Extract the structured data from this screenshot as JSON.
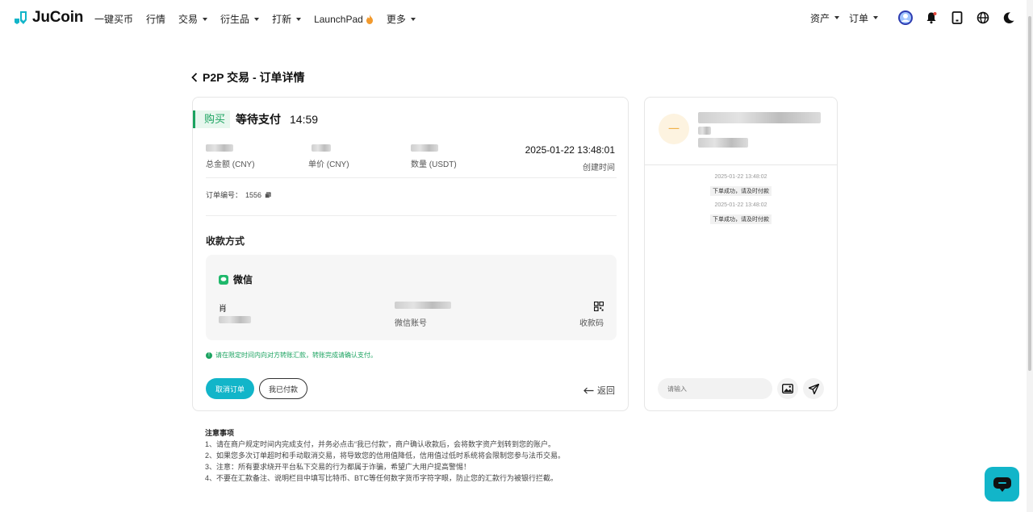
{
  "nav": {
    "brand": "JuCoin",
    "items": [
      {
        "label": "一键买币",
        "dropdown": false
      },
      {
        "label": "行情",
        "dropdown": false
      },
      {
        "label": "交易",
        "dropdown": true
      },
      {
        "label": "衍生品",
        "dropdown": true
      },
      {
        "label": "打新",
        "dropdown": true
      },
      {
        "label": "LaunchPad",
        "dropdown": false
      },
      {
        "label": "更多",
        "dropdown": true
      }
    ],
    "right_items": [
      {
        "label": "资产"
      },
      {
        "label": "订单"
      }
    ],
    "icons": [
      "avatar-icon",
      "bell-icon",
      "download-icon",
      "globe-icon",
      "moon-icon"
    ]
  },
  "page": {
    "title": "P2P 交易 - 订单详情"
  },
  "order": {
    "side": "购买",
    "status": "等待支付",
    "countdown": "14:59",
    "total_label": "总金额 (CNY)",
    "price_label": "单价 (CNY)",
    "qty_label": "数量 (USDT)",
    "created_time": "2025-01-22 13:48:01",
    "created_label": "创建时间",
    "order_no_label": "订单编号：",
    "order_no": "1556"
  },
  "payment": {
    "section_title": "收款方式",
    "method": "微信",
    "name_initial": "肖",
    "account_label": "微信账号",
    "qr_label": "收款码",
    "notice": "请在限定时间内向对方转账汇款，转账完成请确认支付。"
  },
  "actions": {
    "cancel": "取消订单",
    "paid": "我已付款",
    "back": "返回"
  },
  "chat": {
    "avatar_letter": "一",
    "messages": [
      {
        "time": "2025-01-22 13:48:02",
        "text": "下单成功，请及时付款"
      },
      {
        "time": "2025-01-22 13:48:02",
        "text": "下单成功，请及时付款"
      }
    ],
    "input_placeholder": "请输入"
  },
  "notes": {
    "title": "注意事项",
    "lines": [
      "1、请在商户规定时间内完成支付，并务必点击“我已付款”，商户确认收款后，会将数字资产划转到您的账户。",
      "2、如果您多次订单超时和手动取消交易，将导致您的信用值降低，信用值过低时系统将会限制您参与法币交易。",
      "3、注意：所有要求绕开平台私下交易的行为都属于诈骗，希望广大用户提高警惕！",
      "4、不要在汇款备注、说明栏目中填写比特币、BTC等任何数字货币字符字眼，防止您的汇款行为被银行拦截。"
    ]
  },
  "colors": {
    "accent": "#12b5c9",
    "buy_green": "#1ba360",
    "text": "#1a1a1a"
  }
}
